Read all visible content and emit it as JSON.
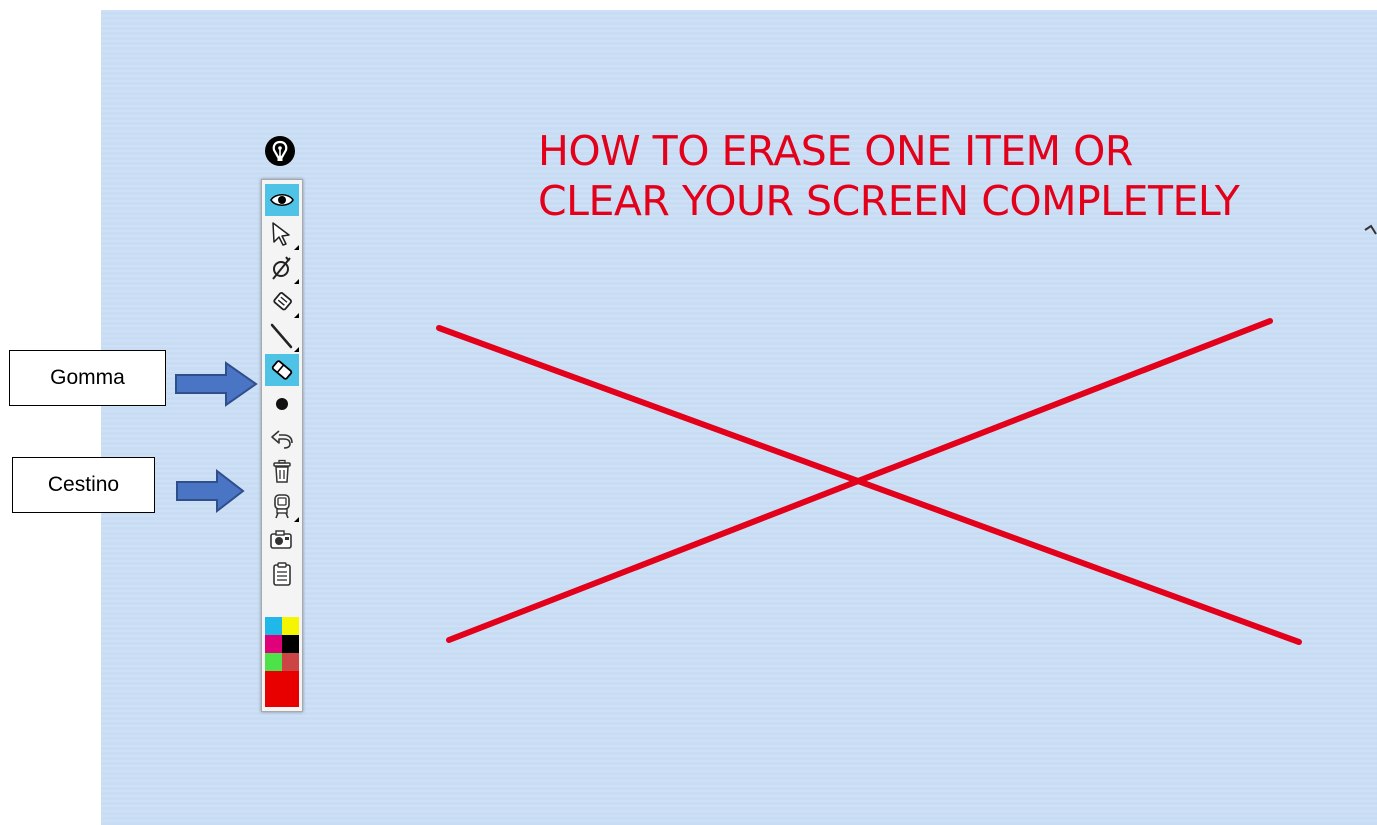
{
  "heading": {
    "line1": "HOW TO ERASE ONE ITEM OR",
    "line2": "CLEAR YOUR SCREEN COMPLETELY",
    "color": "#e3001a"
  },
  "canvas": {
    "background_color": "#c8dcf4",
    "drawing": "red-x-strokes"
  },
  "callouts": {
    "eraser_label": "Gomma",
    "trash_label": "Cestino"
  },
  "toolbar": {
    "logo_icon": "pen-nib-icon",
    "tools": [
      {
        "icon": "eye-icon",
        "active": true
      },
      {
        "icon": "pointer-icon",
        "has_submenu": true
      },
      {
        "icon": "pen-icon",
        "has_submenu": true
      },
      {
        "icon": "highlighter-icon",
        "has_submenu": true
      },
      {
        "icon": "line-icon",
        "has_submenu": true
      },
      {
        "icon": "eraser-icon",
        "active": true
      },
      {
        "icon": "dot-icon"
      },
      {
        "icon": "undo-icon"
      },
      {
        "icon": "trash-icon"
      },
      {
        "icon": "stamp-icon",
        "has_submenu": true
      },
      {
        "icon": "camera-icon"
      },
      {
        "icon": "clipboard-icon"
      }
    ],
    "palette": [
      "#20b8e8",
      "#f5f500",
      "#e0007a",
      "#000000",
      "#4ee24a",
      "#cc4444"
    ],
    "selected_color": "#e80000"
  },
  "accent_colors": {
    "active_tool": "#4fc3e6",
    "arrow_fill": "#4a74c4",
    "arrow_border": "#2f4f8a"
  }
}
